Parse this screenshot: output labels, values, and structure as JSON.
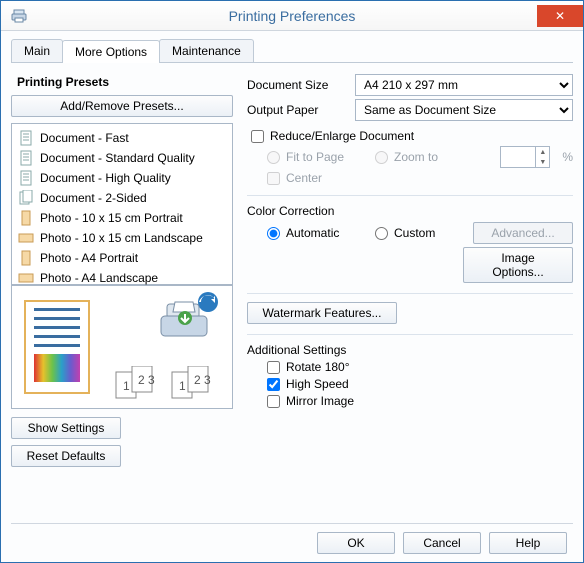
{
  "window": {
    "title": "Printing Preferences"
  },
  "tabs": [
    "Main",
    "More Options",
    "Maintenance"
  ],
  "active_tab": 1,
  "left": {
    "presets_title": "Printing Presets",
    "add_remove": "Add/Remove Presets...",
    "items": [
      "Document - Fast",
      "Document - Standard Quality",
      "Document - High Quality",
      "Document - 2-Sided",
      "Photo - 10 x 15 cm Portrait",
      "Photo - 10 x 15 cm Landscape",
      "Photo - A4 Portrait",
      "Photo - A4 Landscape"
    ],
    "show_settings": "Show Settings",
    "reset_defaults": "Reset Defaults"
  },
  "right": {
    "doc_size_label": "Document Size",
    "doc_size_value": "A4 210 x 297 mm",
    "out_paper_label": "Output Paper",
    "out_paper_value": "Same as Document Size",
    "reduce_enlarge": "Reduce/Enlarge Document",
    "fit_to_page": "Fit to Page",
    "zoom_to": "Zoom to",
    "zoom_value": "",
    "percent": "%",
    "center": "Center",
    "color_corr_title": "Color Correction",
    "automatic": "Automatic",
    "custom": "Custom",
    "advanced": "Advanced...",
    "image_options": "Image Options...",
    "watermark": "Watermark Features...",
    "additional_title": "Additional Settings",
    "rotate": "Rotate 180°",
    "high_speed": "High Speed",
    "mirror": "Mirror Image"
  },
  "checks": {
    "reduce_enlarge": false,
    "center": false,
    "rotate": false,
    "high_speed": true,
    "mirror": false
  },
  "radios": {
    "fit_or_zoom": "fit",
    "color_corr": "automatic"
  },
  "footer": {
    "ok": "OK",
    "cancel": "Cancel",
    "help": "Help"
  }
}
